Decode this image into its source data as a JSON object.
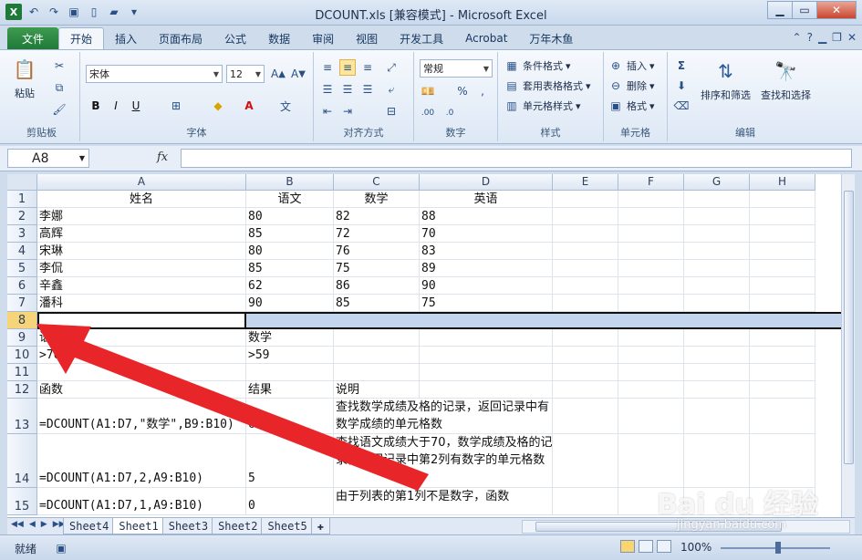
{
  "window": {
    "title": "DCOUNT.xls  [兼容模式] - Microsoft Excel"
  },
  "ribbon_tabs": {
    "file": "文件",
    "items": [
      "开始",
      "插入",
      "页面布局",
      "公式",
      "数据",
      "审阅",
      "视图",
      "开发工具",
      "Acrobat",
      "万年木鱼"
    ],
    "active": "开始"
  },
  "ribbon": {
    "clipboard": {
      "label": "剪贴板",
      "paste": "粘贴"
    },
    "font": {
      "label": "字体",
      "name": "宋体",
      "size": "12",
      "bold": "B",
      "italic": "I",
      "underline": "U"
    },
    "alignment": {
      "label": "对齐方式"
    },
    "number": {
      "label": "数字",
      "format": "常规"
    },
    "styles": {
      "label": "样式",
      "cond_format": "条件格式",
      "table_format": "套用表格格式",
      "cell_styles": "单元格样式"
    },
    "cells": {
      "label": "单元格",
      "insert": "插入",
      "delete": "删除",
      "format": "格式"
    },
    "editing": {
      "label": "编辑",
      "sort": "排序和筛选",
      "find": "查找和选择",
      "sum": "Σ"
    }
  },
  "formula_bar": {
    "name_box": "A8",
    "fx": "fx",
    "content": ""
  },
  "columns": [
    "A",
    "B",
    "C",
    "D",
    "E",
    "F",
    "G",
    "H"
  ],
  "rows": [
    {
      "num": "1",
      "cells": [
        "姓名",
        "语文",
        "数学",
        "英语"
      ]
    },
    {
      "num": "2",
      "cells": [
        "李娜",
        "80",
        "82",
        "88"
      ]
    },
    {
      "num": "3",
      "cells": [
        "高辉",
        "85",
        "72",
        "70"
      ]
    },
    {
      "num": "4",
      "cells": [
        "宋琳",
        "80",
        "76",
        "83"
      ]
    },
    {
      "num": "5",
      "cells": [
        "李侃",
        "85",
        "75",
        "89"
      ]
    },
    {
      "num": "6",
      "cells": [
        "辛鑫",
        "62",
        "86",
        "90"
      ]
    },
    {
      "num": "7",
      "cells": [
        "潘科",
        "90",
        "85",
        "75"
      ]
    },
    {
      "num": "8",
      "cells": [
        "",
        "",
        "",
        ""
      ]
    },
    {
      "num": "9",
      "cells": [
        "语",
        "数学",
        "",
        ""
      ]
    },
    {
      "num": "10",
      "cells": [
        ">70",
        ">59",
        "",
        ""
      ]
    },
    {
      "num": "11",
      "cells": [
        "",
        "",
        "",
        ""
      ]
    },
    {
      "num": "12",
      "cells": [
        "函数",
        "结果",
        "说明",
        ""
      ]
    },
    {
      "num": "13",
      "cells": [
        "=DCOUNT(A1:D7,\"数学\",B9:B10)",
        "6",
        "查找数学成绩及格的记录，返回记录中有数学成绩的单元格数",
        ""
      ]
    },
    {
      "num": "14",
      "cells": [
        "=DCOUNT(A1:D7,2,A9:B10)",
        "5",
        "查找语文成绩大于70，数学成绩及格的记录，返回记录中第2列有数字的单元格数",
        ""
      ]
    },
    {
      "num": "15",
      "cells": [
        "=DCOUNT(A1:D7,1,A9:B10)",
        "0",
        "由于列表的第1列不是数字，函数",
        ""
      ]
    }
  ],
  "sheets": [
    "Sheet4",
    "Sheet1",
    "Sheet3",
    "Sheet2",
    "Sheet5"
  ],
  "active_sheet": "Sheet1",
  "status": {
    "ready": "就绪",
    "zoom": "100%"
  },
  "watermark": {
    "brand": "Bai du 经验",
    "url": "jingyan.baidu.com"
  },
  "colors": {
    "file_tab": "#1f7a3a",
    "selection": "#c4d6ee",
    "arrow": "#e8262a"
  }
}
